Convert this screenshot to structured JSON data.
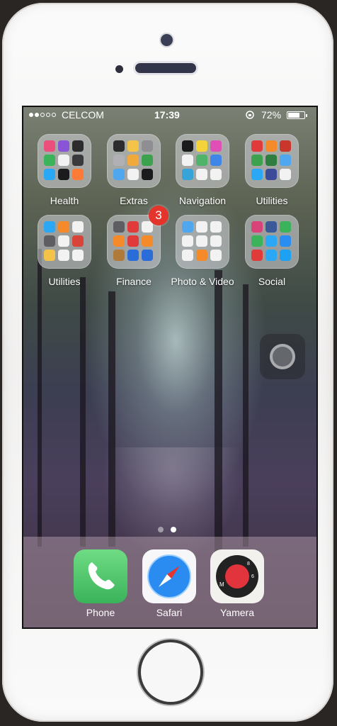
{
  "status": {
    "carrier": "CELCOM",
    "time": "17:39",
    "battery": "72%",
    "battery_level": 0.72
  },
  "folders": [
    {
      "label": "Health",
      "badge": null,
      "minis": [
        "#ec4f7b",
        "#8a54d6",
        "#2c2c2e",
        "#3ab35a",
        "#f2f2f2",
        "#3a3a3c",
        "#2aa8f5",
        "#1b1b1d",
        "#ff7a34"
      ]
    },
    {
      "label": "Extras",
      "badge": null,
      "minis": [
        "#2c2c2e",
        "#f4c34a",
        "#8e8e93",
        "#b0b0b5",
        "#f0a93a",
        "#3da24e",
        "#4fa7f0",
        "#f2f2f2",
        "#1b1b1d"
      ]
    },
    {
      "label": "Navigation",
      "badge": null,
      "minis": [
        "#1b1b1d",
        "#f4d23a",
        "#df4fb5",
        "#f2f2f2",
        "#4fb36a",
        "#3f86e8",
        "#36a3d9",
        "#f2f2f2",
        "#f2f2f2"
      ]
    },
    {
      "label": "Utilities",
      "badge": null,
      "minis": [
        "#e03a3a",
        "#f58a2a",
        "#c8362c",
        "#3da24e",
        "#2f7e3f",
        "#4fa7f0",
        "#2aa8f5",
        "#3c4a9a",
        "#f2f2f2"
      ]
    },
    {
      "label": "Utilities",
      "badge": null,
      "minis": [
        "#2aa8f5",
        "#f58a2a",
        "#f2f2f2",
        "#5d5d62",
        "#f2f2f2",
        "#d8443a",
        "#f4c34a",
        "#f2f2f2",
        "#f2f2f2"
      ]
    },
    {
      "label": "Finance",
      "badge": "3",
      "minis": [
        "#5d5d62",
        "#e03a3a",
        "#f2f2f2",
        "#f58a2a",
        "#e03a3a",
        "#f58a2a",
        "#b07a3a",
        "#2a6dd9",
        "#2a6dd9"
      ]
    },
    {
      "label": "Photo & Video",
      "badge": null,
      "minis": [
        "#4fa7f0",
        "#f2f2f2",
        "#f2f2f2",
        "#f2f2f2",
        "#f2f2f2",
        "#f2f2f2",
        "#f2f2f2",
        "#f58a2a",
        "#f2f2f2"
      ]
    },
    {
      "label": "Social",
      "badge": null,
      "minis": [
        "#d8437a",
        "#3b5998",
        "#3ab35a",
        "#3ab35a",
        "#2aa8f5",
        "#2a8ef0",
        "#e03a3a",
        "#2aa8f5",
        "#1da1f2"
      ]
    }
  ],
  "dock": [
    {
      "label": "Phone"
    },
    {
      "label": "Safari"
    },
    {
      "label": "Yamera"
    }
  ]
}
